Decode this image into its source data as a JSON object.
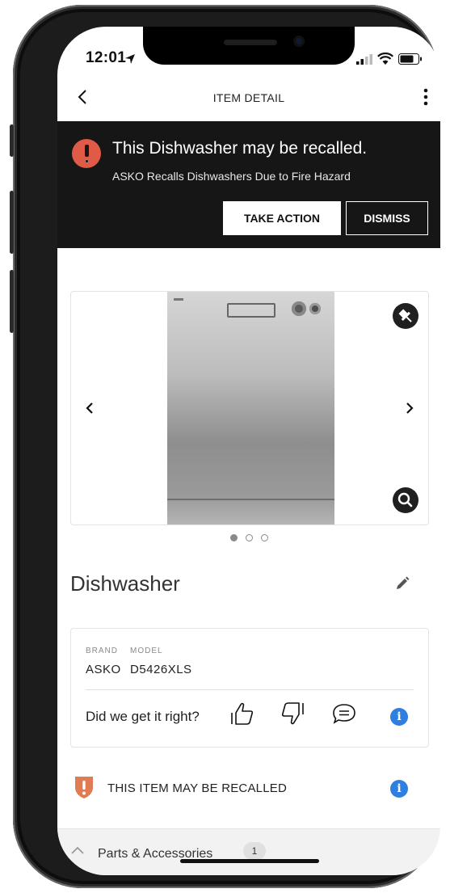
{
  "status_bar": {
    "time": "12:01"
  },
  "app_bar": {
    "title": "ITEM DETAIL"
  },
  "recall_banner": {
    "title": "This Dishwasher may be recalled.",
    "subtitle": "ASKO Recalls Dishwashers Due to Fire Hazard",
    "take_action_label": "TAKE ACTION",
    "dismiss_label": "DISMISS",
    "colors": {
      "background": "#161616",
      "alert": "#e05a48"
    }
  },
  "gallery": {
    "image_count": 3,
    "active_index": 0
  },
  "item": {
    "title": "Dishwasher",
    "brand_label": "BRAND",
    "model_label": "MODEL",
    "brand": "ASKO",
    "model": "D5426XLS"
  },
  "feedback": {
    "question": "Did we get it right?",
    "icons": [
      "thumbs-up-icon",
      "thumbs-down-icon",
      "comment-icon",
      "info-icon"
    ]
  },
  "recall_notice": {
    "text": "THIS ITEM MAY BE RECALLED",
    "icon": "shield-warning-icon",
    "color": "#e07b53"
  },
  "parts_section": {
    "label": "Parts & Accessories",
    "count": "1"
  },
  "accent_color": "#2f7fe0"
}
